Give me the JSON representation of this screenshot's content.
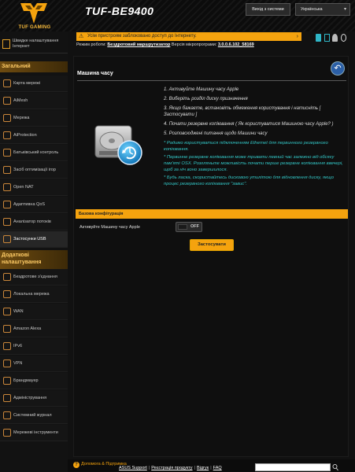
{
  "header": {
    "logo_text": "TUF GAMING",
    "model": "TUF-BE9400",
    "logout": "Вихід з системи",
    "language": "Українська"
  },
  "quick_setup": "Швидке налаштування Інтернет",
  "sidebar": {
    "general_title": "Загальний",
    "general_items": [
      {
        "label": "Карта мережі",
        "icon": "network-map-icon"
      },
      {
        "label": "AiMesh",
        "icon": "aimesh-icon"
      },
      {
        "label": "Мережа",
        "icon": "network-icon"
      },
      {
        "label": "AiProtection",
        "icon": "aiprotection-icon"
      },
      {
        "label": "Батьківський контроль",
        "icon": "parental-control-icon"
      },
      {
        "label": "Засіб оптимізації ігор",
        "icon": "game-boost-icon"
      },
      {
        "label": "Open NAT",
        "icon": "open-nat-icon"
      },
      {
        "label": "Адаптивна QoS",
        "icon": "qos-icon"
      },
      {
        "label": "Аналізатор потоків",
        "icon": "traffic-analyzer-icon"
      },
      {
        "label": "Застосунки USB",
        "icon": "usb-icon"
      }
    ],
    "advanced_title": "Додаткові налаштування",
    "advanced_items": [
      {
        "label": "Бездротове з'єднання",
        "icon": "wireless-icon"
      },
      {
        "label": "Локальна мережа",
        "icon": "lan-icon"
      },
      {
        "label": "WAN",
        "icon": "wan-icon"
      },
      {
        "label": "Amazon Alexa",
        "icon": "alexa-icon"
      },
      {
        "label": "IPv6",
        "icon": "ipv6-icon"
      },
      {
        "label": "VPN",
        "icon": "vpn-icon"
      },
      {
        "label": "Брандмауер",
        "icon": "firewall-icon"
      },
      {
        "label": "Адміністрування",
        "icon": "administration-icon"
      },
      {
        "label": "Системний журнал",
        "icon": "system-log-icon"
      },
      {
        "label": "Мережеві інструменти",
        "icon": "network-tools-icon"
      }
    ]
  },
  "status": {
    "notice": "Усім пристроям заблоковано доступ до Інтернету.",
    "mode_label": "Режим роботи:",
    "mode_value": "Бездротовий маршрутизатор",
    "firmware_label": "Версія мікропрограми:",
    "firmware_value": "3.0.0.6.102_58169"
  },
  "main": {
    "title": "Машина часу",
    "steps": [
      "1. Активуйте Машину часу Apple",
      "2. Виберіть розділ диску призначення",
      "3. Якщо бажаєте, встановіть обмеження користування і натисніть [ Застосувати ]",
      "4. Почати резервне копіювання ( Як користуватися Машиною часу Apple? )",
      "5. Розповсюджені питання щодо Машини часу"
    ],
    "notes": [
      "* Радимо користуватися підключенням Ethernet для первинного резервного копіювання.",
      "* Первинне резервне копіювання може тривати певний час залежно від обсягу пам'яті OSX. Розгляньте можливість почати перше резервне копіювання ввечері, щоб за ніч воно завершилося.",
      "* Будь ласка, скористайтесь дисковою утилітою для відновлення диску, якщо процес резервного копіювання \"завис\"."
    ],
    "config_title": "Базова конфігурація",
    "enable_label": "Активуйте Машину часу Apple",
    "toggle_state": "OFF",
    "apply_label": "Застосувати"
  },
  "footer": {
    "help": "Допомога & Підтримка",
    "links": [
      "ASUS Support",
      "Реєстрація продукту",
      "Відгук",
      "FAQ"
    ]
  },
  "colors": {
    "accent": "#f5a30e",
    "note_text": "#33c7c7",
    "background": "#111111"
  }
}
